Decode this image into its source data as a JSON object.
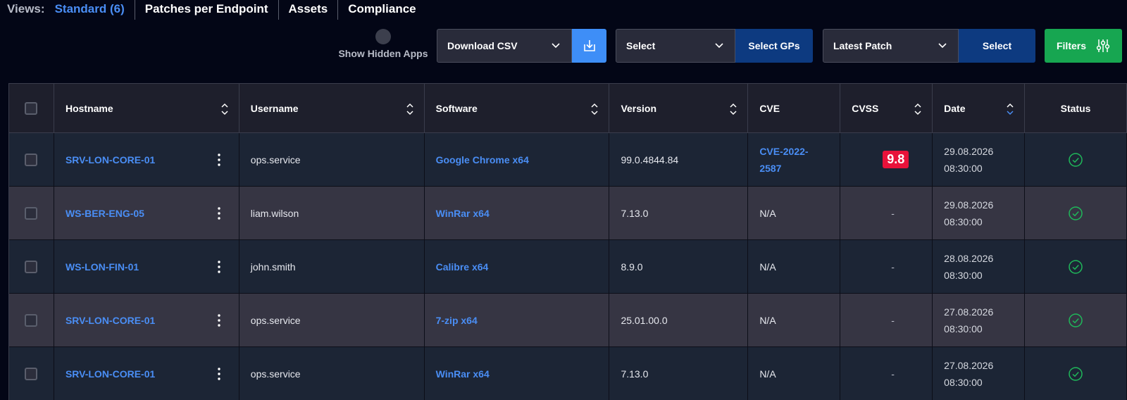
{
  "views": {
    "label": "Views:",
    "tabs": [
      {
        "label": "Standard (6)",
        "active": true
      },
      {
        "label": "Patches per Endpoint"
      },
      {
        "label": "Assets"
      },
      {
        "label": "Compliance"
      }
    ]
  },
  "toolbar": {
    "hidden_apps_label": "Show Hidden Apps",
    "download_select": "Download CSV",
    "gp_select": "Select",
    "gp_button": "Select GPs",
    "patch_select": "Latest Patch",
    "patch_button": "Select",
    "filters_button": "Filters"
  },
  "table": {
    "columns": [
      "Hostname",
      "Username",
      "Software",
      "Version",
      "CVE",
      "CVSS",
      "Date",
      "Status"
    ],
    "rows": [
      {
        "hostname": "SRV-LON-CORE-01",
        "username": "ops.service",
        "software": "Google Chrome x64",
        "version": "99.0.4844.84",
        "cve_line1": "CVE-2022-",
        "cve_line2": "2587",
        "cvss": "9.8",
        "date": "29.08.2026",
        "time": "08:30:00"
      },
      {
        "hostname": "WS-BER-ENG-05",
        "username": "liam.wilson",
        "software": "WinRar x64",
        "version": "7.13.0",
        "cve": "N/A",
        "cvss_empty": "-",
        "date": "29.08.2026",
        "time": "08:30:00"
      },
      {
        "hostname": "WS-LON-FIN-01",
        "username": "john.smith",
        "software": "Calibre x64",
        "version": "8.9.0",
        "cve": "N/A",
        "cvss_empty": "-",
        "date": "28.08.2026",
        "time": "08:30:00"
      },
      {
        "hostname": "SRV-LON-CORE-01",
        "username": "ops.service",
        "software": "7-zip x64",
        "version": "25.01.00.0",
        "cve": "N/A",
        "cvss_empty": "-",
        "date": "27.08.2026",
        "time": "08:30:00"
      },
      {
        "hostname": "SRV-LON-CORE-01",
        "username": "ops.service",
        "software": "WinRar x64",
        "version": "7.13.0",
        "cve": "N/A",
        "cvss_empty": "-",
        "date": "27.08.2026",
        "time": "08:30:00"
      }
    ]
  },
  "colors": {
    "accent": "#4a8ef5",
    "cvss_critical": "#e8123a",
    "success": "#17a651",
    "status_ok": "#1fb85a"
  },
  "icons": {
    "download": "download-icon",
    "filters": "sliders-icon",
    "status": "check-circle-icon",
    "row_menu": "kebab-icon"
  }
}
